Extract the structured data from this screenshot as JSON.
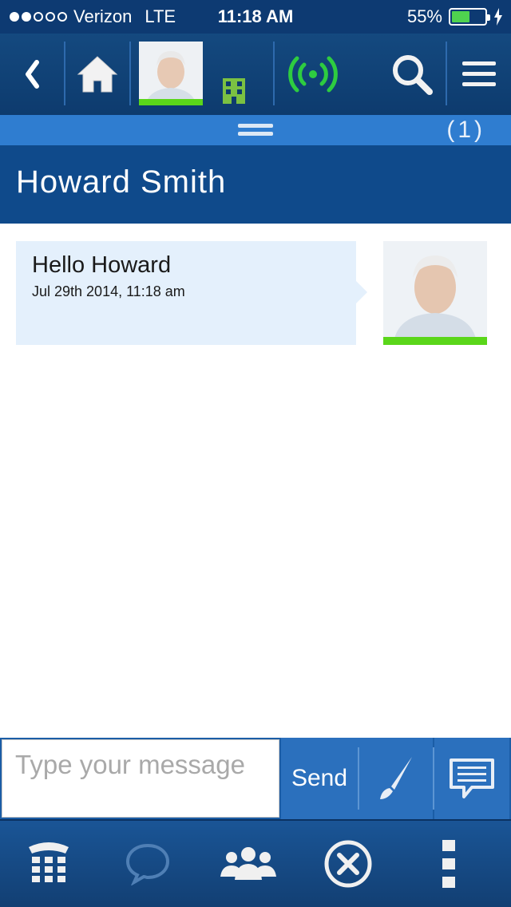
{
  "status_bar": {
    "carrier": "Verizon",
    "network": "LTE",
    "time": "11:18 AM",
    "battery_percent": "55%",
    "battery_level": 0.55,
    "signal_bars": 2
  },
  "toolbar": {
    "icons": [
      "back-chevron-icon",
      "home-icon",
      "avatar",
      "building-icon",
      "broadcast-icon",
      "search-icon",
      "menu-icon"
    ],
    "presence_color": "#5ad61a"
  },
  "drawer": {
    "count": "(1)"
  },
  "conversation": {
    "contact_name": "Howard Smith",
    "messages": [
      {
        "text": "Hello Howard",
        "timestamp": "Jul 29th 2014, 11:18 am"
      }
    ]
  },
  "composer": {
    "placeholder": "Type your message",
    "value": "",
    "send_label": "Send"
  },
  "bottom_nav": {
    "icons": [
      "dialpad-icon",
      "chat-bubble-icon",
      "contacts-icon",
      "close-circle-icon",
      "more-vertical-icon"
    ]
  },
  "colors": {
    "header": "#0f4a8b",
    "accent": "#2f7dd0",
    "bubble": "#e4f0fc",
    "presence": "#5ad61a"
  }
}
